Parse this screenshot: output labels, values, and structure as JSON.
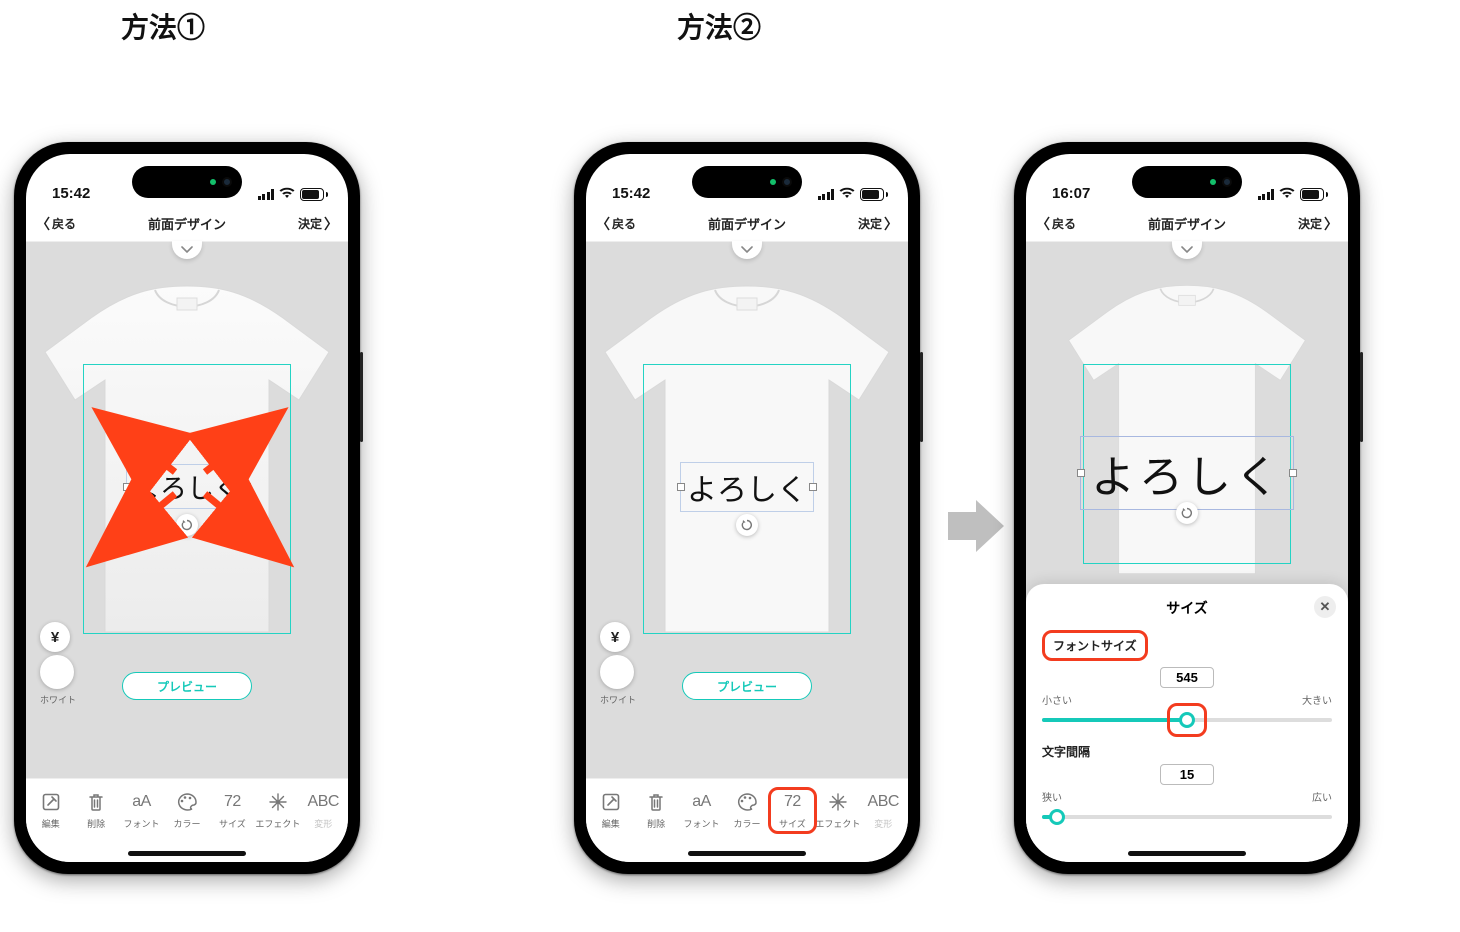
{
  "headings": {
    "method1": "方法①",
    "method2": "方法②"
  },
  "phone1": {
    "time": "15:42",
    "battery": "76",
    "back": "戻る",
    "title": "前面デザイン",
    "confirm": "決定",
    "canvas_text": "よろしく",
    "yen": "¥",
    "swatch_label": "ホワイト",
    "preview": "プレビュー",
    "toolbar": [
      {
        "label": "編集",
        "icon": "edit-square-icon"
      },
      {
        "label": "削除",
        "icon": "trash-icon"
      },
      {
        "label": "フォント",
        "icon": "font-aa-icon",
        "glyph": "aA"
      },
      {
        "label": "カラー",
        "icon": "palette-icon"
      },
      {
        "label": "サイズ",
        "icon": "size-72-icon",
        "glyph": "72"
      },
      {
        "label": "エフェクト",
        "icon": "sparkle-icon"
      },
      {
        "label": "変形",
        "icon": "transform-abc-icon",
        "glyph": "ABC"
      }
    ]
  },
  "phone2": {
    "time": "15:42",
    "battery": "76",
    "back": "戻る",
    "title": "前面デザイン",
    "confirm": "決定",
    "canvas_text": "よろしく",
    "yen": "¥",
    "swatch_label": "ホワイト",
    "preview": "プレビュー",
    "toolbar_highlight_index": 4,
    "toolbar": [
      {
        "label": "編集",
        "icon": "edit-square-icon"
      },
      {
        "label": "削除",
        "icon": "trash-icon"
      },
      {
        "label": "フォント",
        "icon": "font-aa-icon",
        "glyph": "aA"
      },
      {
        "label": "カラー",
        "icon": "palette-icon"
      },
      {
        "label": "サイズ",
        "icon": "size-72-icon",
        "glyph": "72"
      },
      {
        "label": "エフェクト",
        "icon": "sparkle-icon"
      },
      {
        "label": "変形",
        "icon": "transform-abc-icon",
        "glyph": "ABC"
      }
    ]
  },
  "phone3": {
    "time": "16:07",
    "battery": "73",
    "back": "戻る",
    "title": "前面デザイン",
    "confirm": "決定",
    "canvas_text": "よろしく",
    "panel": {
      "title": "サイズ",
      "font_size_label": "フォントサイズ",
      "small": "小さい",
      "large": "大きい",
      "font_size_value": "545",
      "font_size_percent": 50,
      "spacing_label": "文字間隔",
      "narrow": "狭い",
      "wide": "広い",
      "spacing_value": "15",
      "spacing_percent": 5
    }
  }
}
